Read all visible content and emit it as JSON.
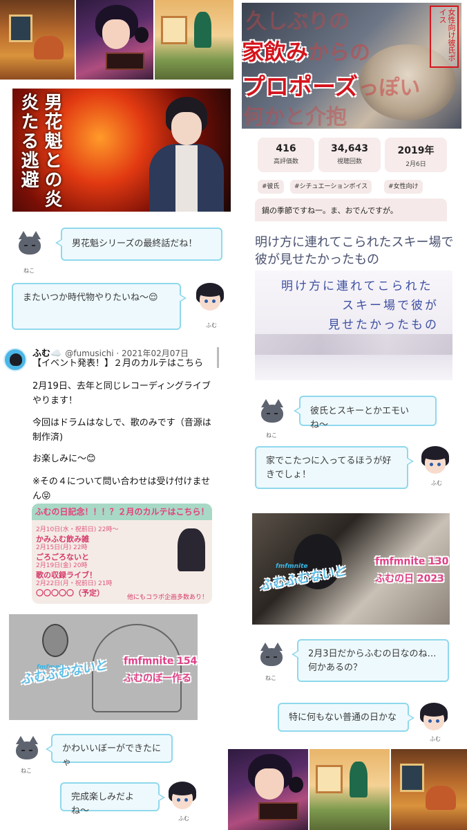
{
  "chat": {
    "bubble1": "男花魁シリーズの最終話だね！",
    "bubble2": "またいつか時代物やりたいね〜😌",
    "bubble3": "彼氏とスキーとかエモいね〜",
    "bubble4": "家でこたつに入ってるほうが好きでしょ！",
    "bubble5": "2月3日だからふむの日なのね…何かあるの？",
    "bubble6": "特に何もない普通の日かな",
    "bubble7": "かわいいぼーができたにゃ",
    "bubble8": "完成楽しみだよね〜",
    "cat_name": "ねこ",
    "boy_name": "ふむ"
  },
  "flame_card": {
    "title": "男花魁との炎炎たる逃避"
  },
  "tweet": {
    "display_name": "ふむ☁️",
    "handle_date": "@fumusichi · 2021年02月07日",
    "line1": "【イベント発表！】２月のカルテはこちら",
    "body1": "2月19日、去年と同じレコーディングライブやります！",
    "body2": "今回はドラムはなしで、歌のみです（音源は制作済)",
    "body3": "お楽しみに〜😊",
    "body4": "※その４について問い合わせは受け付けません😝",
    "card": {
      "header": "ふむの日記念！！！？２月のカルテはこちら！",
      "rows": [
        {
          "date": "2月10日(水・祝前日) 22時〜",
          "title": "かみふむ飲み雑"
        },
        {
          "date": "2月15日(月) 22時",
          "title": "ごろごろないと"
        },
        {
          "date": "2月19日(金) 20時",
          "title": "歌の収録ライブ！"
        },
        {
          "date": "2月22日(月・祝前日) 21時",
          "title": "〇〇〇〇〇（予定）"
        }
      ],
      "footer": "他にもコラボ企画多数あり！"
    }
  },
  "video": {
    "thumb_line1": "久しぶりの",
    "thumb_line2a": "家飲み",
    "thumb_line2b": "からの",
    "thumb_line3a": "プロポーズ",
    "thumb_line3b": "っぽい",
    "thumb_line4": "何かと介抱",
    "thumb_badge": "女性向け彼氏ボイス",
    "stats": [
      {
        "value": "416",
        "label": "高評価数"
      },
      {
        "value": "34,643",
        "label": "視聴回数"
      },
      {
        "value": "2019年",
        "label": "2月6日"
      }
    ],
    "tags": [
      "#彼氏",
      "#シチュエーションボイス",
      "#女性向け"
    ],
    "description": "鍋の季節ですね一。ま、おでんですが。"
  },
  "ski": {
    "title": "明け方に連れてこられたスキー場で彼が見せたかったもの",
    "line1": "明け方に連れてこられた",
    "line2": "スキー場で彼が",
    "line3": "見せたかったもの"
  },
  "banner1": {
    "logo_small": "fmfmnite",
    "logo_big": "ふむふむないと",
    "episode": "fmfmnite 130",
    "subtitle": "ふむの日 2023"
  },
  "banner2": {
    "logo_small": "fmfmnite",
    "logo_big": "ふむふむないと",
    "episode": "fmfmnite 154",
    "subtitle": "ふむのぼー作る"
  },
  "colors": {
    "bubble_fill": "#eef9fd",
    "bubble_border": "#8fd8ec",
    "accent_pink": "#e23f87",
    "thumb_red": "#d4151d"
  }
}
